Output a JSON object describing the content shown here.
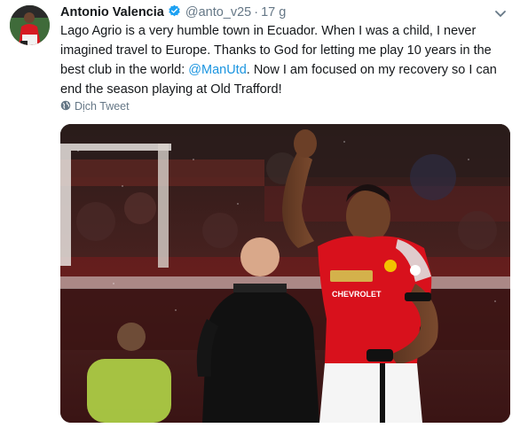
{
  "tweet": {
    "author_name": "Antonio Valencia",
    "handle": "@anto_v25",
    "separator": "·",
    "time": "17 g",
    "text_before_link": "Lago Agrio is a very humble town in Ecuador. When I was a child, I never imagined travel to Europe. Thanks to God for letting me play 10 years in the best club in the world: ",
    "mention": "@ManUtd",
    "text_after_link": ". Now I am focused on my recovery so I can end the season playing at Old Trafford!",
    "translate_label": "Dịch Tweet"
  },
  "photo": {
    "shirt_sponsor": "CHEVROLET"
  },
  "colors": {
    "link": "#1b95e0",
    "verified": "#1da1f2",
    "secondary_text": "#657786",
    "shirt_red": "#d8111c"
  }
}
